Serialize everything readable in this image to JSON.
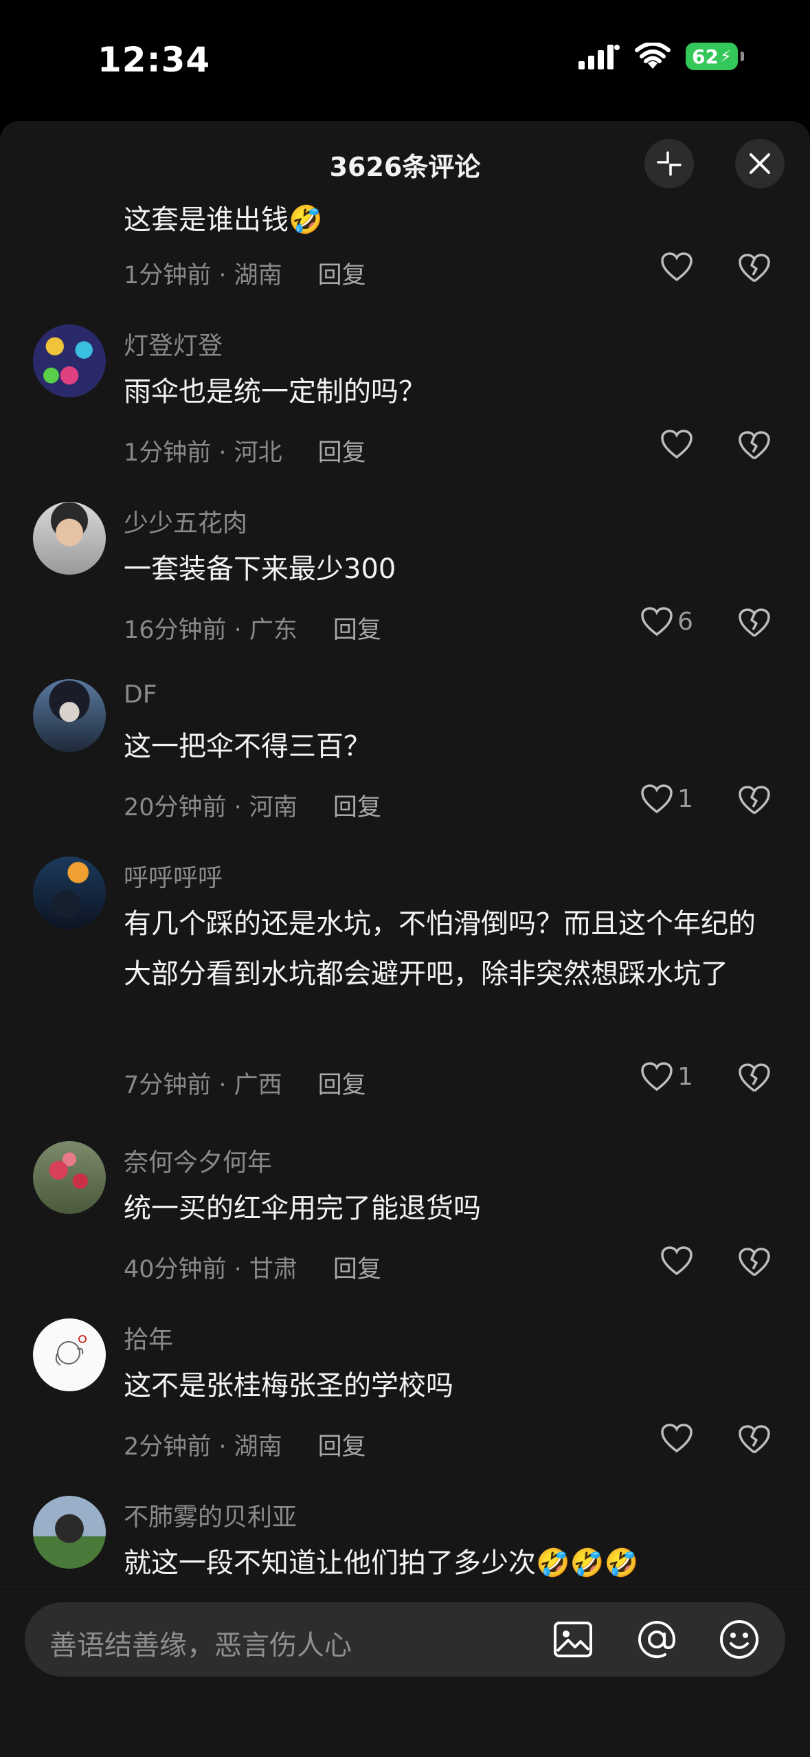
{
  "status_bar": {
    "time": "12:34",
    "battery": "62"
  },
  "header": {
    "title": "3626条评论"
  },
  "comments": [
    {
      "username": "",
      "text": "这套是谁出钱",
      "emoji": "🤣",
      "time_location": "1分钟前 · 湖南",
      "reply": "回复",
      "likes": ""
    },
    {
      "username": "灯登灯登",
      "text": "雨伞也是统一定制的吗？",
      "time_location": "1分钟前 · 河北",
      "reply": "回复",
      "likes": ""
    },
    {
      "username": "少少五花肉",
      "text": "一套装备下来最少300",
      "time_location": "16分钟前 · 广东",
      "reply": "回复",
      "likes": "6"
    },
    {
      "username": "DF",
      "text": "这一把伞不得三百？",
      "time_location": "20分钟前 · 河南",
      "reply": "回复",
      "likes": "1"
    },
    {
      "username": "呼呼呼呼",
      "text": "有几个踩的还是水坑，不怕滑倒吗？而且这个年纪的大部分看到水坑都会避开吧，除非突然想踩水坑了",
      "time_location": "7分钟前 · 广西",
      "reply": "回复",
      "likes": "1"
    },
    {
      "username": "奈何今夕何年",
      "text": "统一买的红伞用完了能退货吗",
      "time_location": "40分钟前 · 甘肃",
      "reply": "回复",
      "likes": ""
    },
    {
      "username": "拾年",
      "text": "这不是张桂梅张圣的学校吗",
      "time_location": "2分钟前 · 湖南",
      "reply": "回复",
      "likes": ""
    },
    {
      "username": "不肺雾的贝利亚",
      "text": "就这一段不知道让他们拍了多少次",
      "emoji": "🤣🤣🤣",
      "time_location": "",
      "reply": "",
      "likes": ""
    }
  ],
  "input": {
    "placeholder": "善语结善缘，恶言伤人心"
  },
  "icons": [
    "collapse-icon",
    "close-icon",
    "heart-icon",
    "broken-heart-icon",
    "image-icon",
    "at-icon",
    "emoji-icon"
  ],
  "colors": {
    "sheet_bg": "#161616",
    "input_bg": "#2d2d2d",
    "battery": "#34c759"
  }
}
